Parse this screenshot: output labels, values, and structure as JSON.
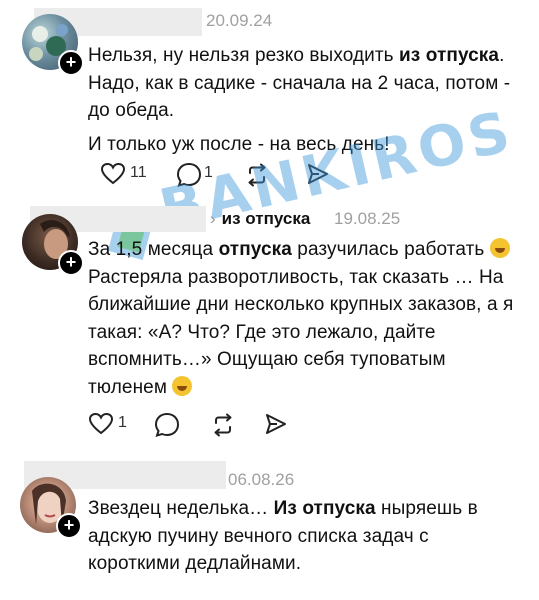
{
  "watermark": "BANKIROS",
  "colors": {
    "text": "#111111",
    "date": "#a0a0a0",
    "redaction": "#ececec",
    "watermark": "#3c96dc"
  },
  "posts": [
    {
      "date": "20.09.24",
      "paragraphs": [
        [
          {
            "t": "Нельзя, ну нельзя резко выходить "
          },
          {
            "b": "из отпуска"
          },
          {
            "t": ". Надо, как в садике - сначала на 2 часа, потом - до обеда."
          }
        ],
        [
          {
            "t": "И только уж после - на весь день!"
          }
        ]
      ],
      "likes": "11",
      "replies": "1"
    },
    {
      "reply_to": "из отпуска",
      "date": "19.08.25",
      "paragraphs": [
        [
          {
            "t": "За 1,5 месяца "
          },
          {
            "b": "отпуска"
          },
          {
            "t": " разучилась работать "
          },
          {
            "e": "grinning-sweat-emoji"
          },
          {
            "t": " Растеряла разворотливость, так сказать … На ближайшие дни  несколько крупных заказов, а я такая: «А? Что? Где это лежало, дайте вспомнить…» Ощущаю себя туповатым тюленем "
          },
          {
            "e": "zany-face-emoji"
          }
        ]
      ],
      "likes": "1",
      "replies": ""
    },
    {
      "date": "06.08.26",
      "paragraphs": [
        [
          {
            "t": "Звездец неделька… "
          },
          {
            "b": "Из отпуска"
          },
          {
            "t": " ныряешь в адскую пучину вечного списка задач с короткими дедлайнами."
          }
        ]
      ]
    }
  ],
  "icons": [
    "heart-icon",
    "comment-icon",
    "repost-icon",
    "share-icon",
    "plus-icon"
  ]
}
